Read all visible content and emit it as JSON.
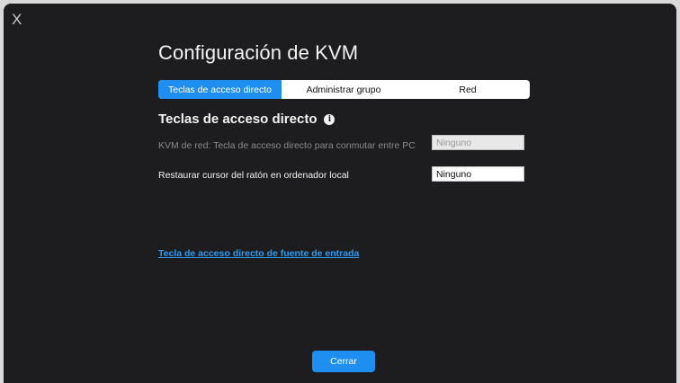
{
  "window": {
    "close_label": "X"
  },
  "header": {
    "title": "Configuración de KVM"
  },
  "tabs": [
    {
      "label": "Teclas de acceso directo",
      "active": true
    },
    {
      "label": "Administrar grupo",
      "active": false
    },
    {
      "label": "Red",
      "active": false
    }
  ],
  "section": {
    "title": "Teclas de acceso directo",
    "info_icon": "info-icon"
  },
  "rows": [
    {
      "label": "KVM de red: Tecla de acceso directo para conmutar entre PC",
      "value": "Ninguno",
      "enabled": false
    },
    {
      "label": "Restaurar cursor del ratón en ordenador local",
      "value": "Ninguno",
      "enabled": true
    }
  ],
  "link": {
    "label": "Tecla de acceso directo de fuente de entrada"
  },
  "footer": {
    "close_button": "Cerrar"
  },
  "colors": {
    "background": "#1d1d1f",
    "accent": "#1e8ff0",
    "link": "#2f9bf0"
  }
}
